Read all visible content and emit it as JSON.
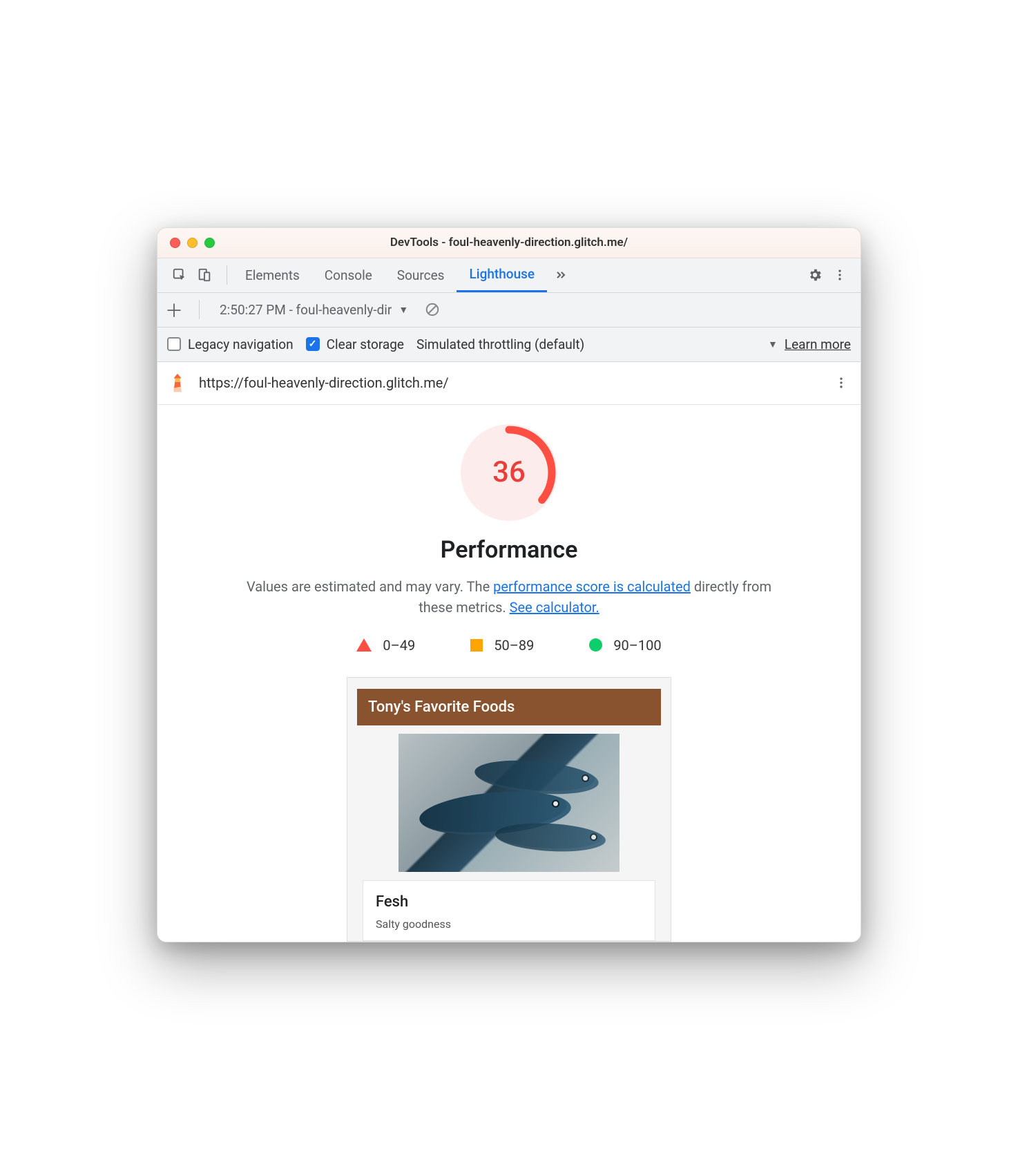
{
  "window": {
    "title": "DevTools - foul-heavenly-direction.glitch.me/"
  },
  "tabs": {
    "items": [
      "Elements",
      "Console",
      "Sources",
      "Lighthouse"
    ],
    "active": "Lighthouse"
  },
  "toolbar": {
    "session": "2:50:27 PM - foul-heavenly-dir"
  },
  "options": {
    "legacy_label": "Legacy navigation",
    "legacy_checked": false,
    "clear_label": "Clear storage",
    "clear_checked": true,
    "throttling_label": "Simulated throttling (default)",
    "learn_more": "Learn more"
  },
  "report": {
    "url": "https://foul-heavenly-direction.glitch.me/",
    "score": "36",
    "score_pct": 36,
    "category": "Performance",
    "desc_prefix": "Values are estimated and may vary. The ",
    "desc_link1": "performance score is calculated",
    "desc_mid": " directly from these metrics. ",
    "desc_link2": "See calculator.",
    "legend": {
      "fail": "0–49",
      "avg": "50–89",
      "pass": "90–100"
    },
    "thumbnail": {
      "header": "Tony's Favorite Foods",
      "title": "Fesh",
      "subtitle": "Salty goodness"
    }
  },
  "colors": {
    "fail": "#ff4e42",
    "avg": "#ffa400",
    "pass": "#0cce6b",
    "link": "#1a73e8"
  }
}
